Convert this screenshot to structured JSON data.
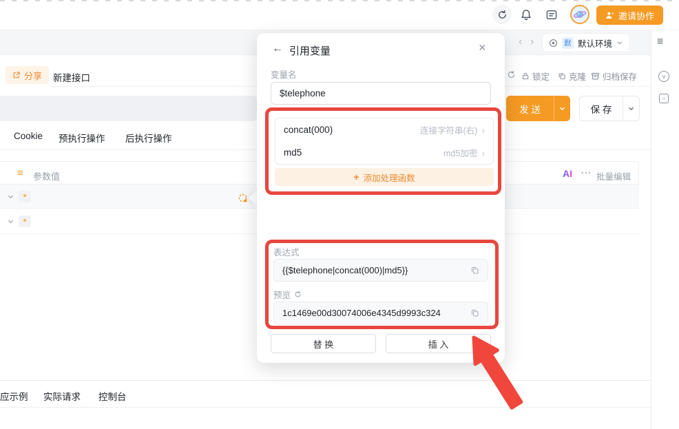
{
  "colors": {
    "accent": "#f59a23",
    "annotation_red": "#e8463f",
    "env_badge_bg": "#e3f0ff",
    "env_badge_text": "#4086e4"
  },
  "icons": {
    "back": "←",
    "close": "×",
    "prev": "‹",
    "next": "›",
    "more": "⋯",
    "menu": "≡",
    "required": "*",
    "plus": "+",
    "version": "v",
    "code": "‹›",
    "ai": "AI"
  },
  "topbar": {
    "invite_label": "邀请协作"
  },
  "env": {
    "badge": "默",
    "name": "默认环境"
  },
  "toolbar": {
    "share_label": "分享",
    "new_api_label": "新建接口",
    "lock_label": "锁定",
    "clone_label": "克隆",
    "archive_label": "归档保存"
  },
  "request_bar": {
    "send_label": "发 送",
    "save_label": "保 存"
  },
  "section_tabs": [
    "Cookie",
    "预执行操作",
    "后执行操作"
  ],
  "param_table": {
    "value_header": "参数值",
    "batch_edit_label": "批量编辑"
  },
  "bottom_tabs": [
    "应示例",
    "实际请求",
    "控制台"
  ],
  "modal": {
    "title": "引用变量",
    "var_name_label": "变量名",
    "var_name_value": "$telephone",
    "functions": [
      {
        "name": "concat(000)",
        "desc": "连接字符串(右)"
      },
      {
        "name": "md5",
        "desc": "md5加密"
      }
    ],
    "add_func_label": "添加处理函数",
    "expression_label": "表达式",
    "expression_value": "{{$telephone|concat(000)|md5}}",
    "preview_label": "预览",
    "preview_value": "1c1469e00d30074006e4345d9993c324",
    "replace_label": "替 换",
    "insert_label": "插 入"
  }
}
